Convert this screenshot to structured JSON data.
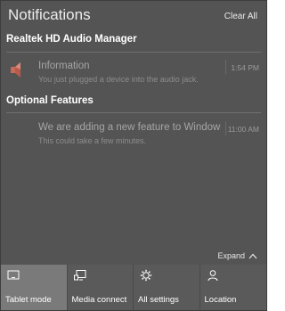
{
  "header": {
    "title": "Notifications",
    "clear_all": "Clear All"
  },
  "groups": [
    {
      "title": "Realtek HD Audio Manager",
      "notification": {
        "icon": "speaker-icon",
        "title": "Information",
        "body": "You just plugged a device into the audio jack.",
        "time": "1:54 PM"
      }
    },
    {
      "title": "Optional Features",
      "notification": {
        "icon": "none",
        "title": "We are adding a new feature to Windows",
        "body": "This could take a few minutes.",
        "time": "11:00 AM"
      }
    }
  ],
  "expand_label": "Expand",
  "quick_actions": [
    {
      "label": "Tablet mode",
      "icon": "tablet-mode-icon",
      "active": true
    },
    {
      "label": "Media connect",
      "icon": "media-connect-icon",
      "active": false
    },
    {
      "label": "All settings",
      "icon": "gear-icon",
      "active": false
    },
    {
      "label": "Location",
      "icon": "location-icon",
      "active": false
    }
  ],
  "colors": {
    "panel_bg": "#545454",
    "tile_bg": "#5a5a5a",
    "tile_active_bg": "#7a7a7a"
  }
}
